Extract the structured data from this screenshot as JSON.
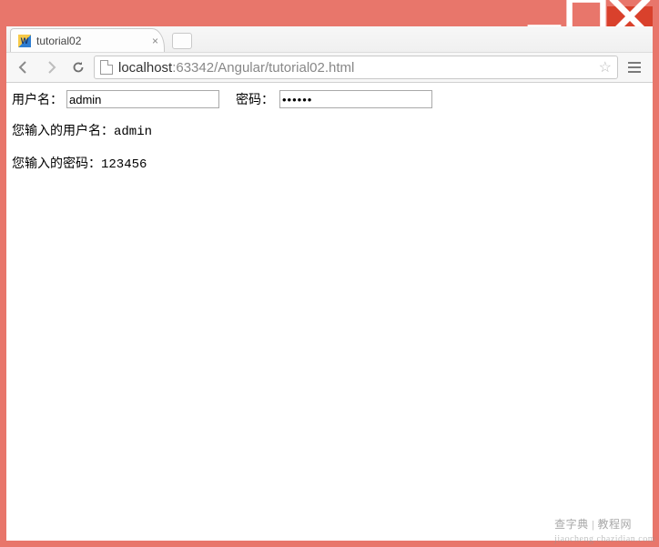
{
  "window": {
    "min_tip": "Minimize",
    "max_tip": "Maximize",
    "close_tip": "Close"
  },
  "tab": {
    "title": "tutorial02",
    "close_tip": "Close tab"
  },
  "address": {
    "host": "localhost",
    "port": ":63342",
    "path": "/Angular/tutorial02.html"
  },
  "form": {
    "username_label": "用户名：",
    "username_value": "admin",
    "password_label": "密码：",
    "password_display": "••••••"
  },
  "output": {
    "user_prefix": "您输入的用户名：",
    "user_value": "admin",
    "pass_prefix": "您输入的密码：",
    "pass_value": "123456"
  },
  "watermark": {
    "line1": "查字典 | 教程网",
    "line2": "jiaocheng.chazidian.com"
  }
}
